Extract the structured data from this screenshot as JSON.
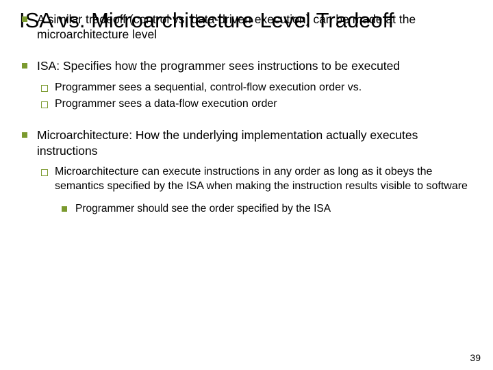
{
  "slide": {
    "title": "ISA vs. Microarchitecture Level Tradeoff",
    "bullets": [
      {
        "text": "A similar tradeoff (control vs. data-driven execution) can be made at the microarchitecture level"
      },
      {
        "text": "ISA: Specifies how the programmer sees instructions to be executed",
        "sub": [
          {
            "text": "Programmer sees a sequential, control-flow execution order vs."
          },
          {
            "text": "Programmer sees a data-flow execution order"
          }
        ]
      },
      {
        "text": "Microarchitecture: How the underlying implementation actually executes instructions",
        "sub": [
          {
            "text": "Microarchitecture can execute instructions in any order as long as it obeys the semantics specified by the ISA when making the instruction results visible to software",
            "subsub": [
              {
                "text": "Programmer should see the order specified by the ISA"
              }
            ]
          }
        ]
      }
    ],
    "page_number": "39"
  }
}
